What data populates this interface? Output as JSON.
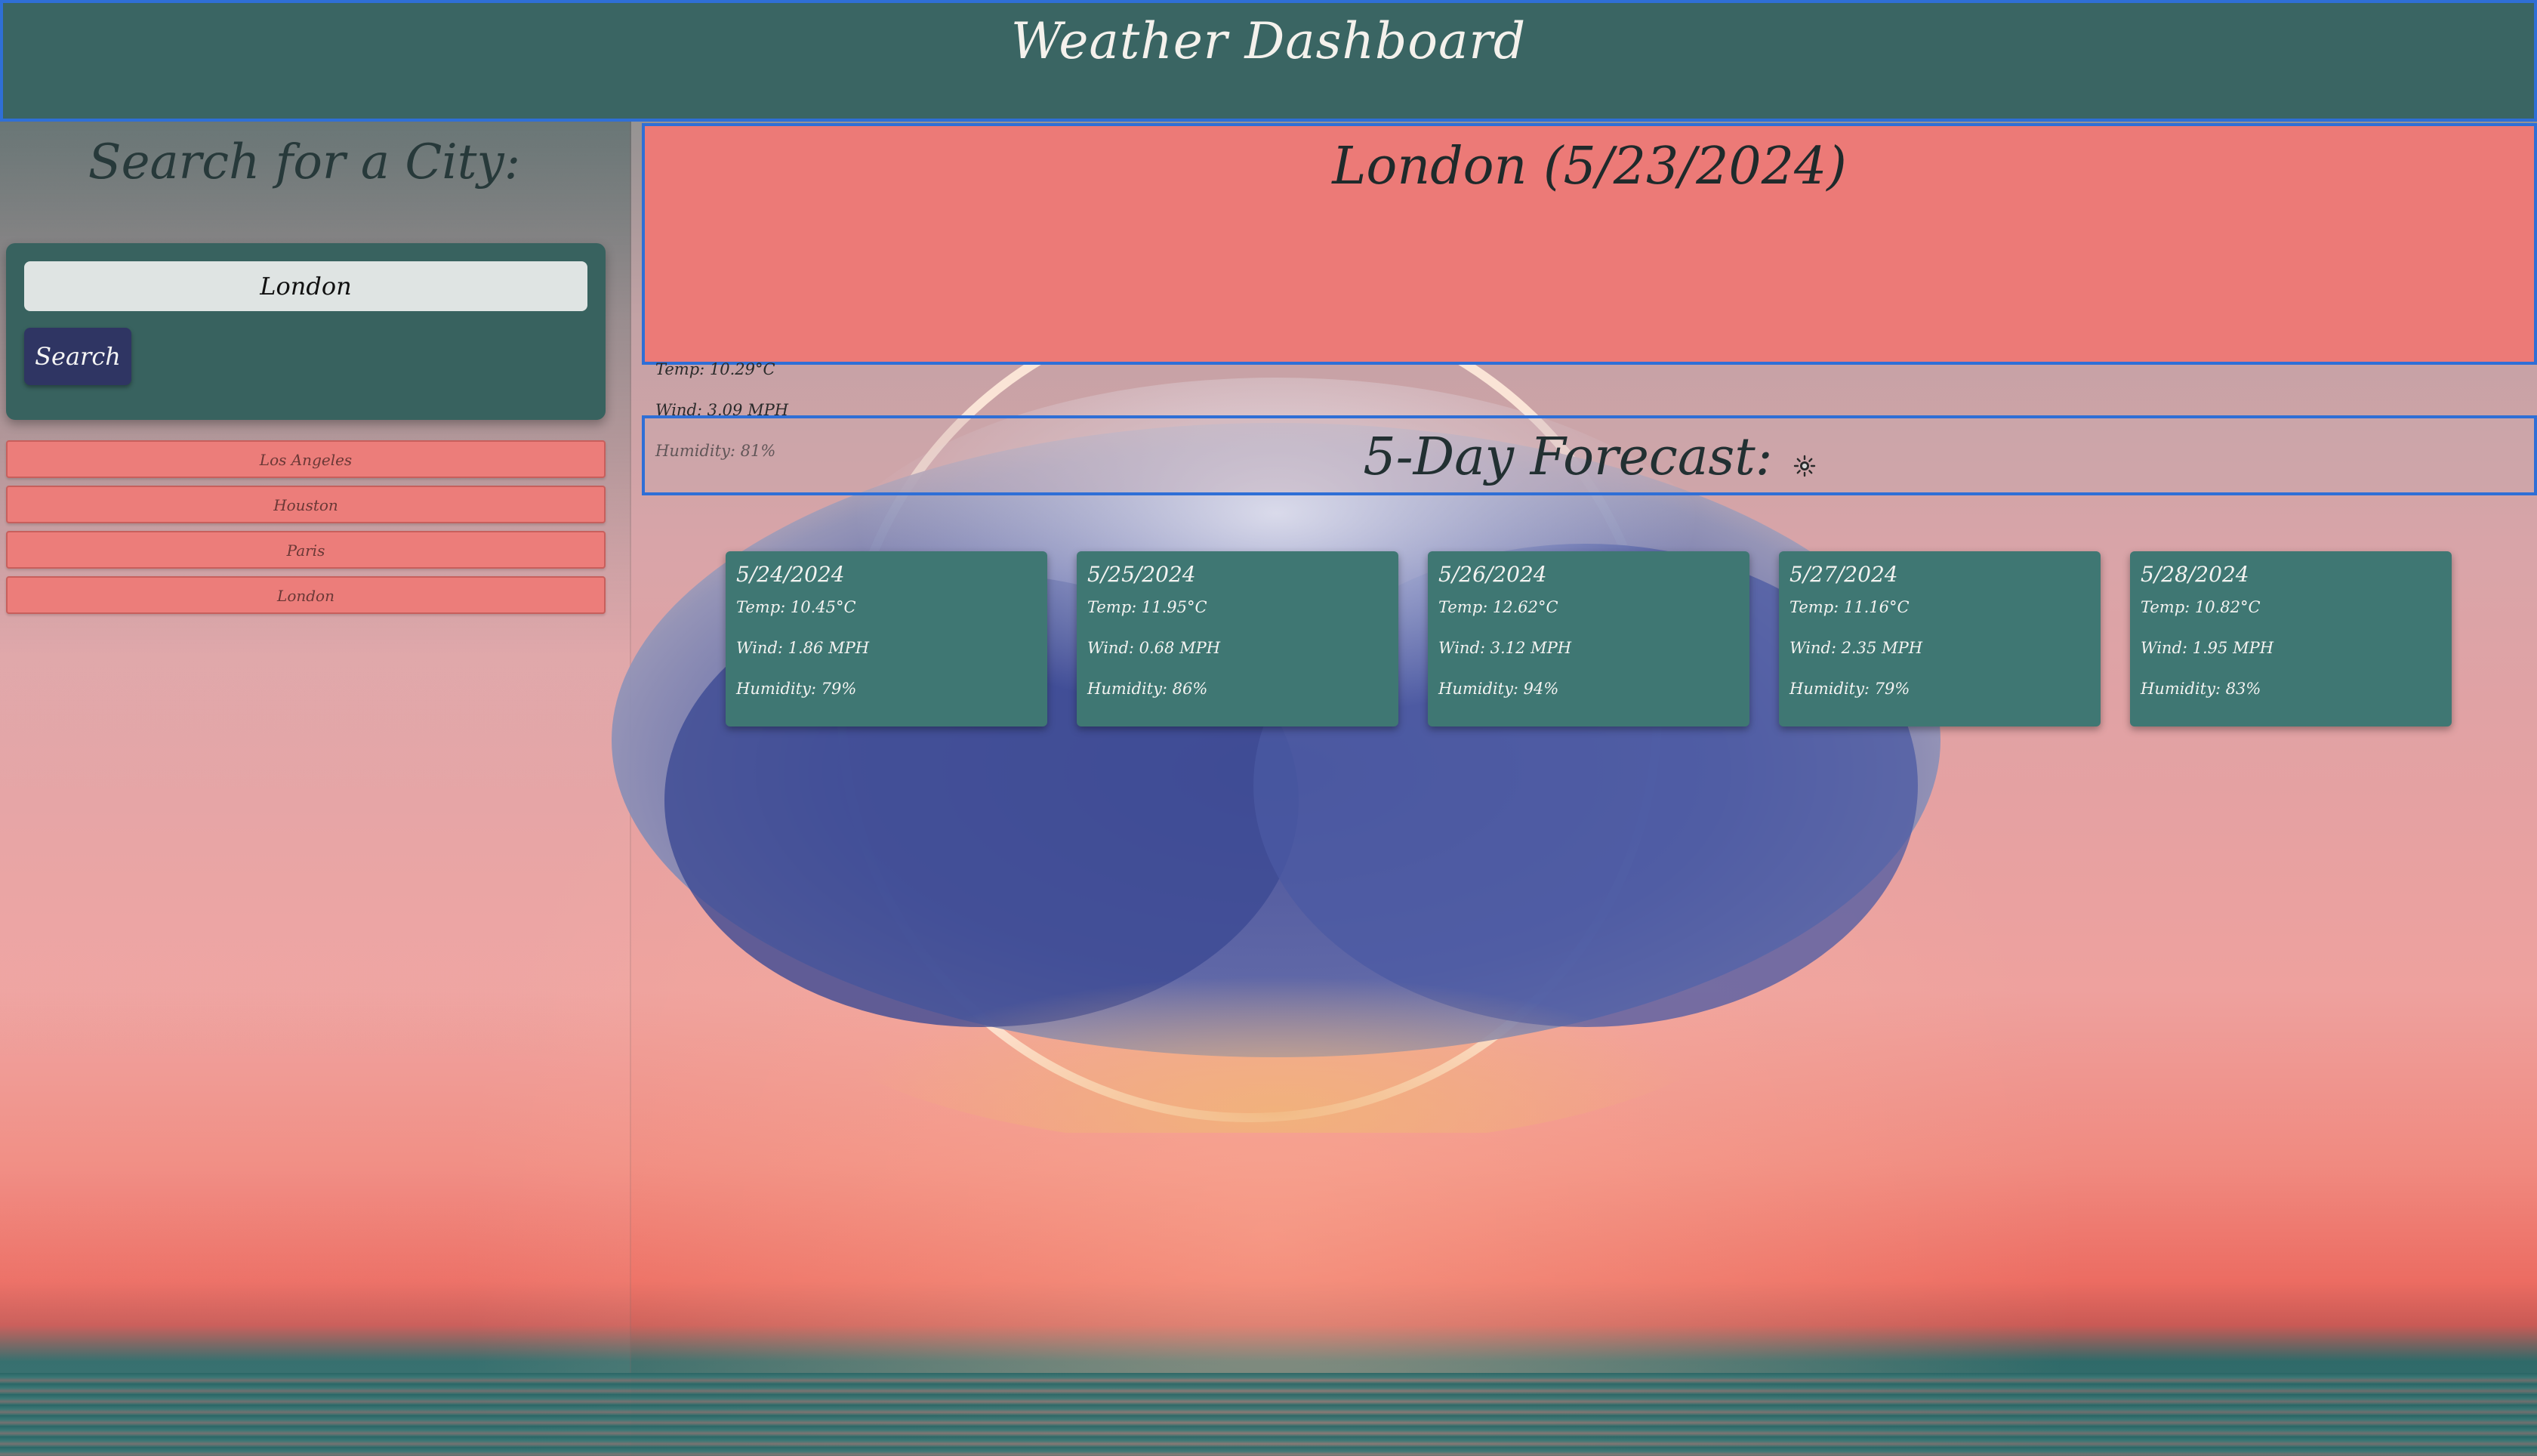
{
  "header": {
    "title": "Weather Dashboard"
  },
  "sidebar": {
    "title": "Search for a City:",
    "search": {
      "value": "London",
      "button_label": "Search"
    },
    "history": [
      "Los Angeles",
      "Houston",
      "Paris",
      "London"
    ]
  },
  "current": {
    "title": "London (5/23/2024)",
    "temp": "Temp: 10.29°C",
    "wind": "Wind: 3.09 MPH",
    "humidity": "Humidity: 81%"
  },
  "forecast": {
    "title": "5-Day Forecast:",
    "icon": "sun-icon",
    "days": [
      {
        "date": "5/24/2024",
        "temp": "Temp: 10.45°C",
        "wind": "Wind: 1.86 MPH",
        "humidity": "Humidity: 79%"
      },
      {
        "date": "5/25/2024",
        "temp": "Temp: 11.95°C",
        "wind": "Wind: 0.68 MPH",
        "humidity": "Humidity: 86%"
      },
      {
        "date": "5/26/2024",
        "temp": "Temp: 12.62°C",
        "wind": "Wind: 3.12 MPH",
        "humidity": "Humidity: 94%"
      },
      {
        "date": "5/27/2024",
        "temp": "Temp: 11.16°C",
        "wind": "Wind: 2.35 MPH",
        "humidity": "Humidity: 79%"
      },
      {
        "date": "5/28/2024",
        "temp": "Temp: 10.82°C",
        "wind": "Wind: 1.95 MPH",
        "humidity": "Humidity: 83%"
      }
    ]
  },
  "colors": {
    "header_bg": "#3a6563",
    "accent_border": "#2f6fd6",
    "current_bg": "#ec7a77",
    "card_bg": "#3f7773",
    "button_bg": "#2f3563"
  }
}
